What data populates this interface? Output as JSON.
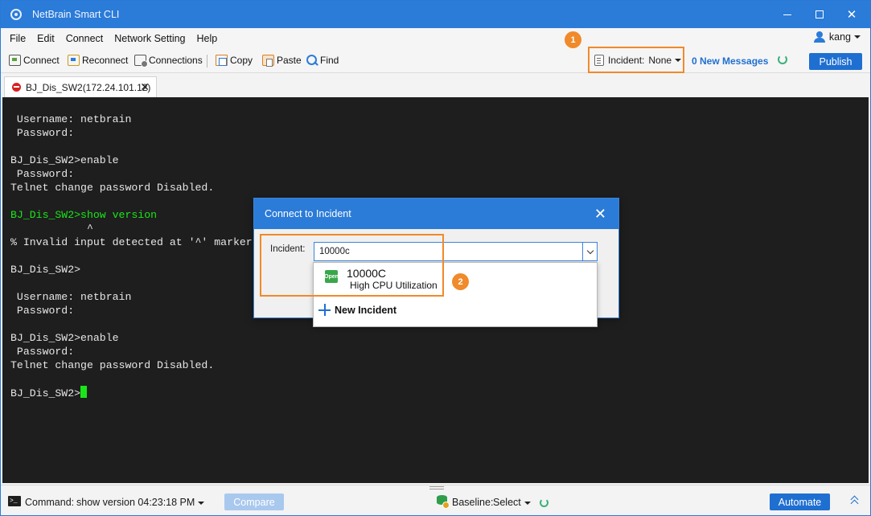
{
  "window": {
    "title": "NetBrain Smart CLI"
  },
  "menu": {
    "items": [
      "File",
      "Edit",
      "Connect",
      "Network Setting",
      "Help"
    ]
  },
  "user": {
    "name": "kang"
  },
  "toolbar": {
    "connect": "Connect",
    "reconnect": "Reconnect",
    "connections": "Connections",
    "copy": "Copy",
    "paste": "Paste",
    "find": "Find"
  },
  "incident": {
    "label": "Incident:",
    "value": "None"
  },
  "messages": {
    "text": "0 New Messages"
  },
  "publish": {
    "label": "Publish"
  },
  "callouts": {
    "one": "1",
    "two": "2"
  },
  "tab": {
    "title": "BJ_Dis_SW2(172.24.101.12)"
  },
  "terminal": {
    "lines": [
      " Username: netbrain",
      " Password:",
      "",
      "BJ_Dis_SW2>enable",
      " Password:",
      "Telnet change password Disabled.",
      "",
      "BJ_Dis_SW2>show version",
      "            ^",
      "% Invalid input detected at '^' marker.",
      "",
      "BJ_Dis_SW2>",
      "",
      " Username: netbrain",
      " Password:",
      "",
      "BJ_Dis_SW2>enable",
      " Password:",
      "Telnet change password Disabled.",
      "",
      "BJ_Dis_SW2>"
    ]
  },
  "dialog": {
    "title": "Connect to Incident",
    "incident_label": "Incident:",
    "input_value": "10000c",
    "options": [
      {
        "icon_text": "Open",
        "id": "10000C",
        "description": "High CPU Utilization"
      }
    ],
    "new_incident": "New Incident"
  },
  "statusbar": {
    "command_label": "Command:",
    "command_value": "show version 04:23:18 PM",
    "compare": "Compare",
    "baseline_label": "Baseline:",
    "baseline_value": "Select",
    "automate": "Automate"
  }
}
